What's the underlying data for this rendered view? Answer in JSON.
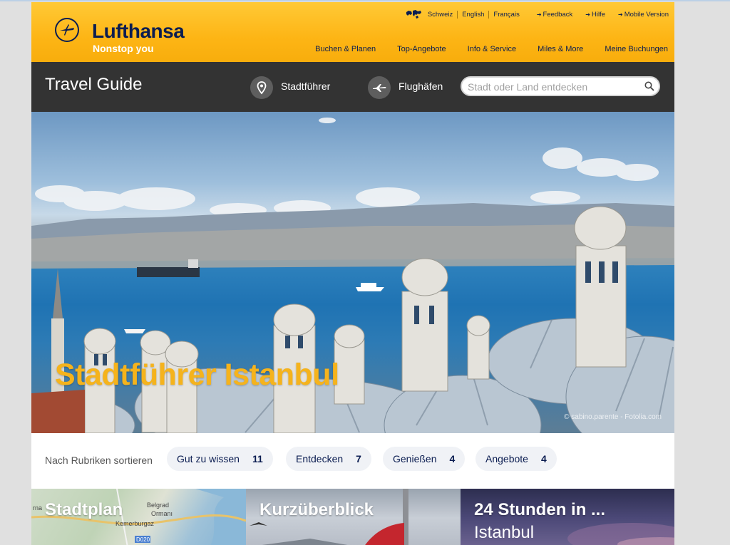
{
  "header": {
    "brand": "Lufthansa",
    "tagline": "Nonstop you",
    "languages": [
      "Schweiz",
      "English",
      "Français"
    ],
    "links": [
      "Feedback",
      "Hilfe",
      "Mobile Version"
    ],
    "nav": [
      "Buchen & Planen",
      "Top-Angebote",
      "Info & Service",
      "Miles & More",
      "Meine Buchungen"
    ]
  },
  "travel_bar": {
    "title": "Travel Guide",
    "city_guide": "Stadtführer",
    "airports": "Flughäfen",
    "search_placeholder": "Stadt oder Land entdecken"
  },
  "hero": {
    "title": "Stadtführer Istanbul",
    "credit": "© sabino.parente - Fotolia.com"
  },
  "filters": {
    "label": "Nach Rubriken sortieren",
    "chips": [
      {
        "label": "Gut zu wissen",
        "count": "11"
      },
      {
        "label": "Entdecken",
        "count": "7"
      },
      {
        "label": "Genießen",
        "count": "4"
      },
      {
        "label": "Angebote",
        "count": "4"
      }
    ]
  },
  "tiles": [
    {
      "title": "Stadtplan",
      "map_labels": [
        "rna",
        "Belgrad",
        "Ormanı",
        "Kemerburgaz",
        "D020"
      ]
    },
    {
      "title": "Kurzüberblick"
    },
    {
      "title": "24 Stunden in ...",
      "subtitle": "Istanbul"
    }
  ],
  "colors": {
    "header_yellow": "#fdb515",
    "brand_navy": "#0b1d51",
    "bar_dark": "#333333",
    "hero_title": "#f5b31c",
    "chip_bg": "#f0f2f6"
  },
  "icons": [
    "crane-logo-icon",
    "globe-icon",
    "location-pin-icon",
    "airplane-icon",
    "search-icon"
  ]
}
